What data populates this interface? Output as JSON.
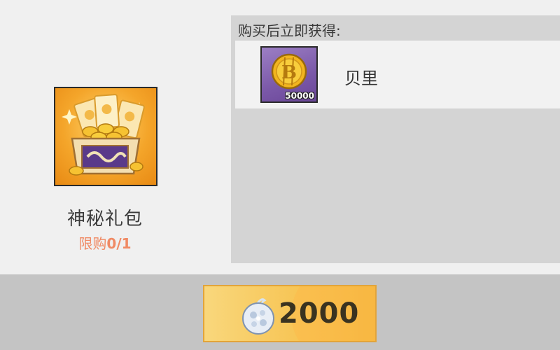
{
  "pack": {
    "name": "神秘礼包",
    "limit_label": "限购",
    "limit_count": "0/1",
    "icon": "treasure-chest-icon"
  },
  "rewards": {
    "header": "购买后立即获得:",
    "items": [
      {
        "name": "贝里",
        "quantity": "50000",
        "icon": "berry-coin-icon"
      }
    ]
  },
  "price": {
    "value": "2000",
    "currency_icon": "diamond-fruit-icon"
  },
  "colors": {
    "limit_text": "#f08a64",
    "button_gold": "#f7c555",
    "panel_gray": "#d4d4d4"
  }
}
